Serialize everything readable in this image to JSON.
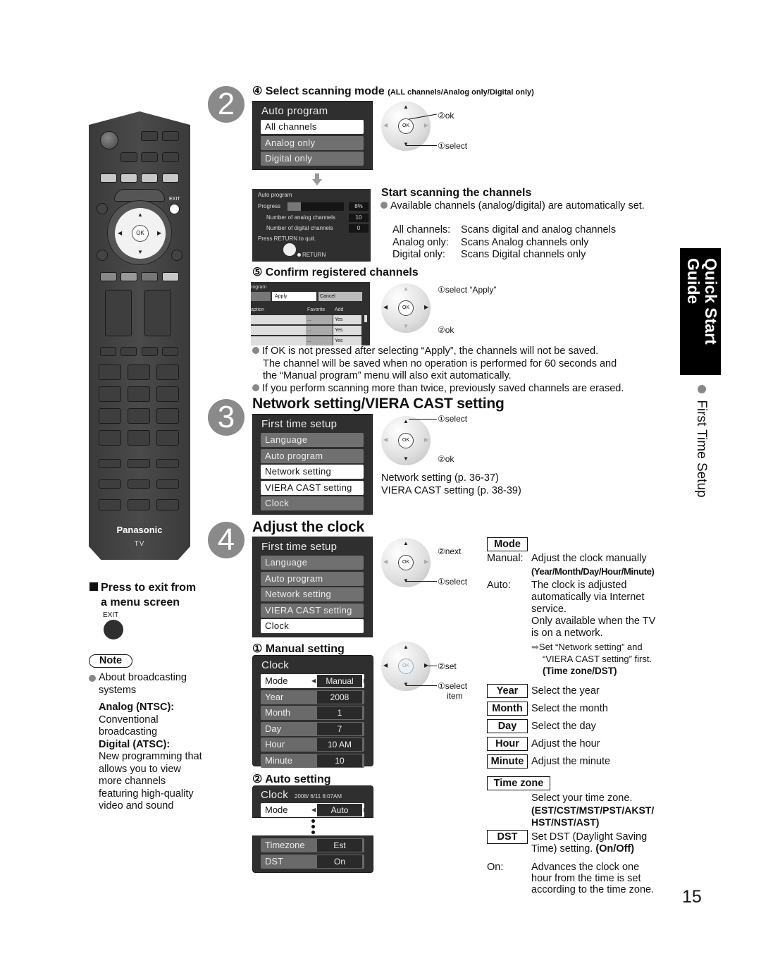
{
  "page_number": "15",
  "side_tab": {
    "title_line1": "Quick Start",
    "title_line2": "Guide",
    "section": "First Time Setup"
  },
  "remote": {
    "brand": "Panasonic",
    "label": "TV",
    "exit_label": "EXIT",
    "ok_label": "OK"
  },
  "exit_note": {
    "title_line1": "Press to exit from",
    "title_line2": "a menu screen",
    "button_label": "EXIT"
  },
  "note": {
    "badge": "Note",
    "bullet": "About broadcasting systems",
    "analog_title": "Analog (NTSC):",
    "analog_desc": "Conventional broadcasting",
    "digital_title": "Digital (ATSC):",
    "digital_desc": "New programming that allows you to view more channels featuring high-quality video and sound"
  },
  "step2": {
    "number": "2",
    "heading_prefix": "④ Select scanning mode",
    "heading_suffix": "(ALL channels/Analog only/Digital only)",
    "menu": {
      "title": "Auto program",
      "items": [
        {
          "label": "All channels",
          "selected": true
        },
        {
          "label": "Analog only",
          "selected": false
        },
        {
          "label": "Digital only",
          "selected": false
        }
      ]
    },
    "dial": {
      "ok": "OK",
      "callout_ok": "②ok",
      "callout_select": "①select"
    },
    "progress_screen": {
      "title": "Auto program",
      "progress_label": "Progress",
      "progress_percent": 8,
      "progress_text": "8%",
      "analog_label": "Number of analog channels",
      "analog_value": "10",
      "digital_label": "Number of digital channels",
      "digital_value": "0",
      "quit_text": "Press RETURN to quit.",
      "return_label": "RETURN"
    },
    "scan": {
      "heading": "Start scanning the channels",
      "bullet": "Available channels (analog/digital) are automatically set.",
      "modes": [
        {
          "term": "All channels:",
          "desc": "Scans digital and analog channels"
        },
        {
          "term": "Analog only:",
          "desc": "Scans Analog channels only"
        },
        {
          "term": "Digital only:",
          "desc": "Scans Digital channels only"
        }
      ]
    },
    "confirm": {
      "heading": "⑤ Confirm registered channels",
      "table_title": "rogram",
      "apply": "Apply",
      "cancel": "Cancel",
      "col_caption": "aption",
      "col_favorite": "Favorite",
      "col_add": "Add",
      "rows": [
        {
          "fav": "...",
          "add": "Yes"
        },
        {
          "fav": "...",
          "add": "Yes"
        },
        {
          "fav": "...",
          "add": "Yes"
        }
      ],
      "callout_select": "①select “Apply”",
      "callout_ok": "②ok",
      "notes": [
        "If OK is not pressed after selecting “Apply”, the channels will not be saved.",
        "The channel will be saved when no operation is performed for 60 seconds and",
        "the “Manual program” menu will also exit automatically.",
        "If you perform scanning more than twice, previously saved channels are erased."
      ]
    }
  },
  "step3": {
    "number": "3",
    "heading": "Network setting/VIERA CAST setting",
    "menu": {
      "title": "First time setup",
      "items": [
        {
          "label": "Language",
          "selected": false
        },
        {
          "label": "Auto program",
          "selected": false
        },
        {
          "label": "Network setting",
          "selected": true
        },
        {
          "label": "VIERA CAST setting",
          "selected": true
        },
        {
          "label": "Clock",
          "selected": false
        }
      ]
    },
    "dial": {
      "ok": "OK",
      "callout_select": "①select",
      "callout_ok": "②ok"
    },
    "refs": [
      "Network setting (p. 36-37)",
      "VIERA CAST setting (p. 38-39)"
    ]
  },
  "step4": {
    "number": "4",
    "heading": "Adjust the clock",
    "menu": {
      "title": "First time setup",
      "items": [
        {
          "label": "Language",
          "selected": false
        },
        {
          "label": "Auto program",
          "selected": false
        },
        {
          "label": "Network setting",
          "selected": false
        },
        {
          "label": "VIERA CAST setting",
          "selected": false
        },
        {
          "label": "Clock",
          "selected": true
        }
      ]
    },
    "dial": {
      "ok": "OK",
      "callout_next": "②next",
      "callout_select": "①select"
    },
    "manual": {
      "heading": "① Manual setting",
      "title": "Clock",
      "rows": [
        {
          "label": "Mode",
          "value": "Manual",
          "selected": true
        },
        {
          "label": "Year",
          "value": "2008",
          "selected": false
        },
        {
          "label": "Month",
          "value": "1",
          "selected": false
        },
        {
          "label": "Day",
          "value": "7",
          "selected": false
        },
        {
          "label": "Hour",
          "value": "10 AM",
          "selected": false
        },
        {
          "label": "Minute",
          "value": "10",
          "selected": false
        }
      ],
      "dial": {
        "ok": "OK",
        "callout_set": "②set",
        "callout_select": "①select",
        "callout_select2": "item"
      }
    },
    "auto": {
      "heading": "② Auto setting",
      "title": "Clock",
      "timestamp": "2008/ 6/11 8:07AM",
      "mode_label": "Mode",
      "mode_value": "Auto",
      "rows": [
        {
          "label": "Timezone",
          "value": "Est"
        },
        {
          "label": "DST",
          "value": "On"
        }
      ]
    },
    "definitions": {
      "mode_key": "Mode",
      "manual_term": "Manual:",
      "manual_desc": "Adjust the clock manually",
      "manual_fields": "(Year/Month/Day/Hour/Minute)",
      "auto_term": "Auto:",
      "auto_desc_lines": [
        "The clock is adjusted",
        "automatically via Internet",
        "service.",
        "Only available when the TV",
        "is on a network."
      ],
      "auto_arrow_lines": [
        "Set “Network setting” and",
        "“VIERA CAST setting” first."
      ],
      "auto_fields": "(Time zone/DST)",
      "keys": [
        {
          "key": "Year",
          "desc": "Select the year"
        },
        {
          "key": "Month",
          "desc": "Select the month"
        },
        {
          "key": "Day",
          "desc": "Select the day"
        },
        {
          "key": "Hour",
          "desc": "Adjust the hour"
        },
        {
          "key": "Minute",
          "desc": "Adjust the minute"
        }
      ],
      "timezone_key": "Time zone",
      "timezone_desc": "Select your time zone.",
      "timezone_opts_line1": "(EST/CST/MST/PST/AKST/",
      "timezone_opts_line2": "HST/NST/AST)",
      "dst_key": "DST",
      "dst_desc_line1": "Set DST (Daylight Saving",
      "dst_desc_line2": "Time) setting.",
      "dst_opts": "(On/Off)",
      "on_term": "On:",
      "on_desc_lines": [
        "Advances the clock one",
        "hour from the time is set",
        "according to the time zone."
      ]
    }
  }
}
